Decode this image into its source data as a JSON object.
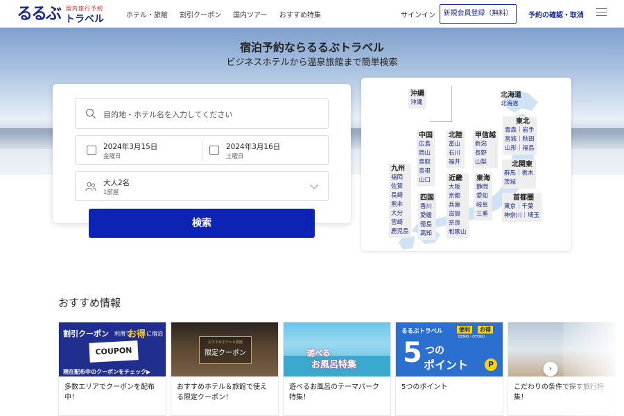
{
  "header": {
    "logo_main": "るるぶ",
    "logo_sub_top": "国内旅行予約",
    "logo_sub_bottom": "トラベル",
    "nav": [
      "ホテル・旅館",
      "割引クーポン",
      "国内ツアー",
      "おすすめ特集"
    ],
    "signin": "サインイン",
    "register": "新規会員登録（無料）",
    "reserve": "予約の確認・取消",
    "menu_icon": "hamburger-icon"
  },
  "hero": {
    "title": "宿泊予約ならるるぶトラベル",
    "subtitle": "ビジネスホテルから温泉旅館まで簡単検索"
  },
  "search": {
    "destination_placeholder": "目的地・ホテル名を入力してください",
    "checkin_date": "2024年3月15日",
    "checkin_weekday": "金曜日",
    "checkout_date": "2024年3月16日",
    "checkout_weekday": "土曜日",
    "guests": "大人2名",
    "rooms": "1部屋",
    "button": "検索"
  },
  "map": {
    "regions": [
      {
        "name": "沖縄",
        "prefs": [
          "沖縄"
        ]
      },
      {
        "name": "北海道",
        "prefs": [
          "北海道"
        ]
      },
      {
        "name": "東北",
        "prefs": [
          "青森｜岩手",
          "宮城｜秋田",
          "山形｜福島"
        ]
      },
      {
        "name": "中国",
        "prefs": [
          "広島",
          "岡山",
          "鳥取",
          "島根",
          "山口"
        ]
      },
      {
        "name": "北陸",
        "prefs": [
          "富山",
          "石川",
          "福井"
        ]
      },
      {
        "name": "甲信越",
        "prefs": [
          "新潟",
          "長野",
          "山梨"
        ]
      },
      {
        "name": "北関東",
        "prefs": [
          "群馬｜栃木",
          "茨城"
        ]
      },
      {
        "name": "九州",
        "prefs": [
          "福岡",
          "佐賀",
          "長崎",
          "熊本",
          "大分",
          "宮崎",
          "鹿児島"
        ]
      },
      {
        "name": "近畿",
        "prefs": [
          "大阪",
          "京都",
          "兵庫",
          "滋賀",
          "奈良",
          "和歌山"
        ]
      },
      {
        "name": "東海",
        "prefs": [
          "静岡",
          "愛知",
          "岐阜",
          "三重"
        ]
      },
      {
        "name": "四国",
        "prefs": [
          "香川",
          "愛媛",
          "徳島",
          "高知"
        ]
      },
      {
        "name": "首都圏",
        "prefs": [
          "東京｜千葉",
          "神奈川｜埼玉"
        ]
      }
    ]
  },
  "recommend": {
    "title": "おすすめ情報",
    "cards": [
      {
        "caption": "多数エリアでクーポンを配布中！",
        "banner_top": "割引クーポン",
        "banner_top2": "利用で",
        "banner_top3": "お得",
        "banner_top4": "に宿泊",
        "banner_mid": "COUPON",
        "banner_bottom": "現在配布中のクーポンをチェック▶"
      },
      {
        "caption": "おすすめホテル＆旅館で使える限定クーポン！",
        "banner_text": "限定クーポン",
        "banner_small": "おすすめホテル＆旅館"
      },
      {
        "caption": "遊べるお風呂のテーマパーク特集！",
        "banner_text1": "遊べる",
        "banner_text2": "お風呂特集"
      },
      {
        "caption": "5つのポイント",
        "banner_top": "るるぶトラベル",
        "banner_tag1": "便利",
        "banner_tag2": "お得",
        "banner_small": "BENRI・OTOKU",
        "banner_big": "5",
        "banner_big2": "つの",
        "banner_big3": "ポイント"
      },
      {
        "caption": "こだわりの条件で探す旅行特集！"
      }
    ],
    "next_icon": "chevron-right-icon"
  }
}
